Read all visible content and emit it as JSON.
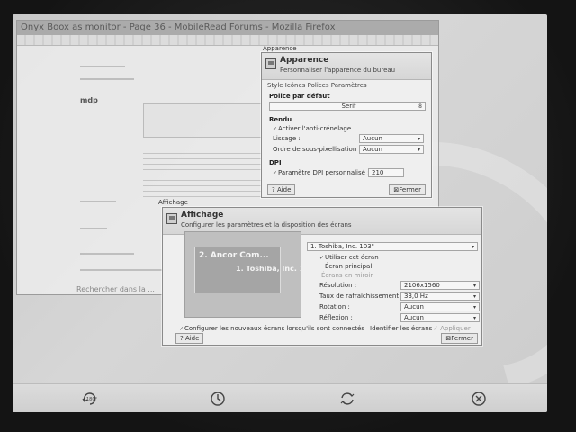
{
  "browser": {
    "title": "Onyx Boox as monitor - Page 36 - MobileRead Forums - Mozilla Firefox",
    "username": "mdp",
    "search_placeholder": "Rechercher dans la ..."
  },
  "apparence": {
    "window_title": "Apparence",
    "title": "Apparence",
    "subtitle": "Personnaliser l'apparence du bureau",
    "tabs": "Style  Icônes  Polices  Paramètres",
    "default_font_section": "Police par défaut",
    "default_font_value": "Serif",
    "default_font_size": "8",
    "rendering_section": "Rendu",
    "antialias_label": "Activer l'anti-crénelage",
    "hinting_label": "Lissage :",
    "hinting_value": "Aucun",
    "subpixel_label": "Ordre de sous-pixellisation :",
    "subpixel_value": "Aucun",
    "dpi_section": "DPI",
    "custom_dpi_label": "Paramètre DPI personnalisé :",
    "custom_dpi_value": "210",
    "help_button": "Aide",
    "close_button": "Fermer"
  },
  "affichage": {
    "window_title": "Affichage",
    "title": "Affichage",
    "subtitle": "Configurer les paramètres et la disposition des écrans",
    "monitor_select": "1. Toshiba, Inc. 103\"",
    "preview_monitor_1": "1. Toshiba, Inc. 1...",
    "preview_monitor_2": "2. Ancor Com...",
    "use_screen_label": "Utiliser cet écran",
    "primary_label": "Écran principal",
    "mirror_label": "Écrans en miroir",
    "resolution_label": "Résolution :",
    "resolution_value": "2106x1560",
    "refresh_label": "Taux de rafraîchissement :",
    "refresh_value": "33,0 Hz",
    "rotation_label": "Rotation :",
    "rotation_value": "Aucun",
    "reflection_label": "Réflexion :",
    "reflection_value": "Aucun",
    "auto_configure_label": "Configurer les nouveaux écrans lorsqu'ils sont connectés",
    "identify_button": "Identifier les écrans",
    "apply_button": "Appliquer",
    "help_button": "Aide",
    "close_button": "Fermer"
  },
  "reader_bar": {
    "rotate_label": "180°",
    "icons": [
      "rotate-180-icon",
      "clock-icon",
      "refresh-icon",
      "close-icon"
    ]
  },
  "colors": {
    "screen_bg": "#d0d0d0",
    "dialog_bg": "#efefef",
    "bezel": "#141414"
  }
}
